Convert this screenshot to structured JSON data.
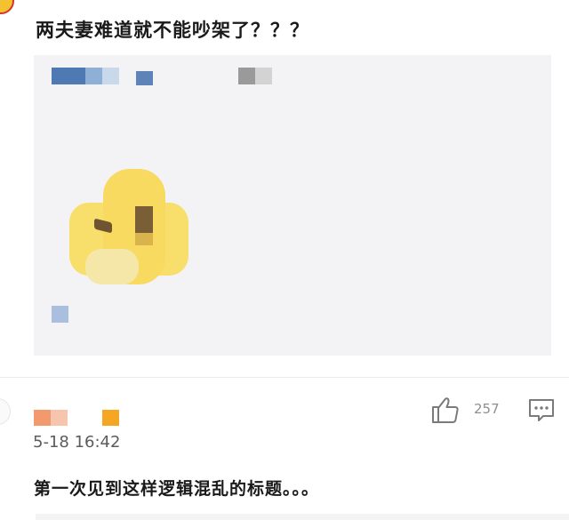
{
  "post": {
    "title": "两夫妻难道就不能吵架了？？？"
  },
  "quoted_card": {
    "emoji_icon": "squinting-face-emoji",
    "colors": {
      "background": "#f3f3f5",
      "emoji": "#f7da5f"
    }
  },
  "comment": {
    "timestamp": "5-18 16:42",
    "like_count": "257",
    "like_icon": "thumbs-up-icon",
    "comment_icon": "comment-icon",
    "text": "第一次见到这样逻辑混乱的标题。。。"
  }
}
